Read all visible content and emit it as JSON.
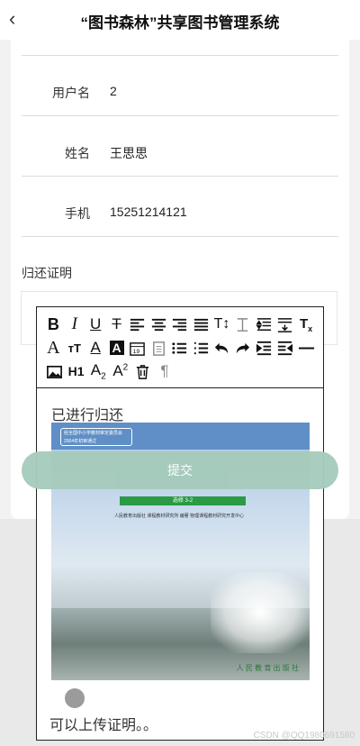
{
  "header": {
    "back_glyph": "‹",
    "title": "“图书森林”共享图书管理系统"
  },
  "form": {
    "rows": [
      {
        "label": "用户名",
        "value": "2"
      },
      {
        "label": "姓名",
        "value": "王思思"
      },
      {
        "label": "手机",
        "value": "15251214121"
      }
    ],
    "proof_label": "归还证明"
  },
  "editor": {
    "toolbar_icons": [
      [
        "bold-icon",
        "italic-icon",
        "underline-icon",
        "strikethrough-icon",
        "align-left-icon",
        "align-center-icon",
        "align-right-icon",
        "align-justify-icon",
        "text-size-icon",
        "letter-spacing-icon",
        "line-height-icon",
        "paragraph-spacing-icon",
        "clear-format-icon"
      ],
      [
        "font-family-icon",
        "font-size-icon",
        "font-color-icon",
        "highlight-color-icon",
        "date-icon",
        "clipboard-icon",
        "bullet-list-icon",
        "ordered-list-icon",
        "undo-icon",
        "redo-icon",
        "indent-icon",
        "outdent-icon",
        "horizontal-rule-icon"
      ],
      [
        "image-icon",
        "heading-h1-icon",
        "subscript-icon",
        "superscript-icon",
        "delete-icon",
        "paragraph-icon"
      ]
    ],
    "content_line1": "已进行归还",
    "content_line2": "可以上传证明。。",
    "book": {
      "badge": "经全国中小学教材审定委员会 2004年初审通过",
      "series": "选修 3-2",
      "publisher": "人民教育出版社 课程教材研究所 编著 物理课程教材研究开发中心",
      "logo": "人 民 教 育 出 版 社"
    }
  },
  "submit_label": "提交",
  "watermark": "CSDN @QQ1980691580"
}
